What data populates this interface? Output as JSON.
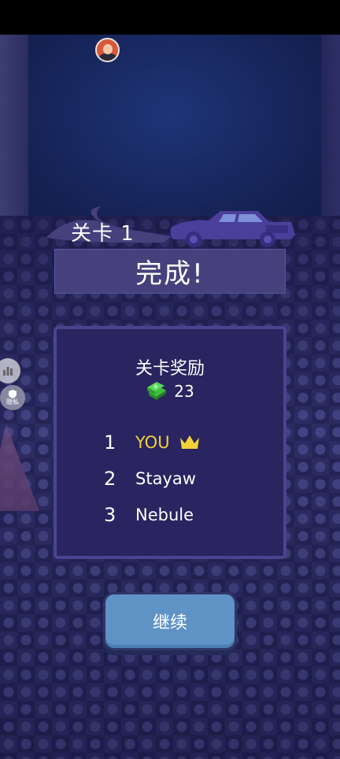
{
  "player": {
    "avatar_icon": "player-avatar-icon"
  },
  "level": {
    "label": "关卡 1",
    "complete_text": "完成!"
  },
  "reward": {
    "title": "关卡奖励",
    "icon": "cash-stack-icon",
    "amount": "23"
  },
  "ranking": [
    {
      "rank": "1",
      "name": "YOU",
      "is_player": true,
      "icon": "crown-icon"
    },
    {
      "rank": "2",
      "name": "Stayaw",
      "is_player": false
    },
    {
      "rank": "3",
      "name": "Nebule",
      "is_player": false
    }
  ],
  "side_buttons": [
    {
      "icon": "leaderboard-icon"
    },
    {
      "label": "隐私",
      "icon": "privacy-shield-icon"
    }
  ],
  "continue_label": "继续",
  "colors": {
    "panel_bg": "#2a2460",
    "panel_border": "#4a4490",
    "highlight": "#f1d23a",
    "button": "#5f93c6"
  }
}
